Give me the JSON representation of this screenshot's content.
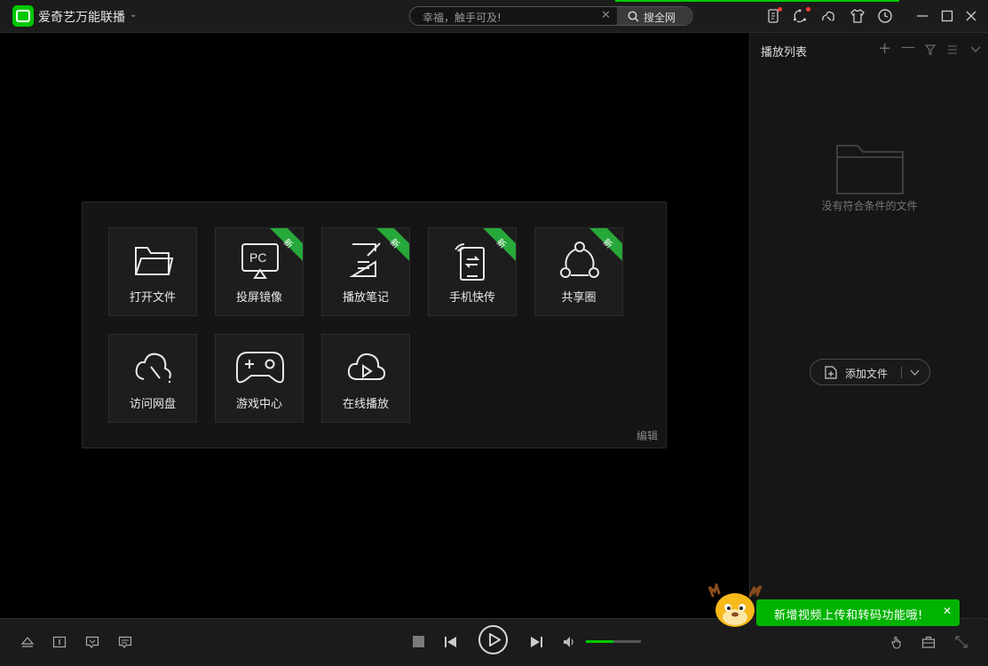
{
  "app": {
    "title": "爱奇艺万能联播"
  },
  "search": {
    "placeholder": "幸福，触手可及!",
    "button_label": "搜全网"
  },
  "tiles": [
    {
      "label": "打开文件",
      "icon": "folder-icon",
      "badge": ""
    },
    {
      "label": "投屏镜像",
      "icon": "pc-cast-icon",
      "badge": "新"
    },
    {
      "label": "播放笔记",
      "icon": "note-edit-icon",
      "badge": "新"
    },
    {
      "label": "手机快传",
      "icon": "phone-transfer-icon",
      "badge": "新"
    },
    {
      "label": "共享圈",
      "icon": "share-circle-icon",
      "badge": "新"
    },
    {
      "label": "访问网盘",
      "icon": "cloud-drive-icon",
      "badge": ""
    },
    {
      "label": "游戏中心",
      "icon": "gamepad-icon",
      "badge": ""
    },
    {
      "label": "在线播放",
      "icon": "cloud-play-icon",
      "badge": ""
    }
  ],
  "panel": {
    "edit_label": "编辑"
  },
  "playlist": {
    "title": "播放列表",
    "empty_text": "没有符合条件的文件",
    "add_file_label": "添加文件"
  },
  "notification": {
    "text": "新增视频上传和转码功能哦!",
    "close": "✕"
  },
  "player": {
    "volume": 0.5
  },
  "colors": {
    "accent": "#00c800",
    "badge": "#27a83a",
    "background": "#000000"
  }
}
